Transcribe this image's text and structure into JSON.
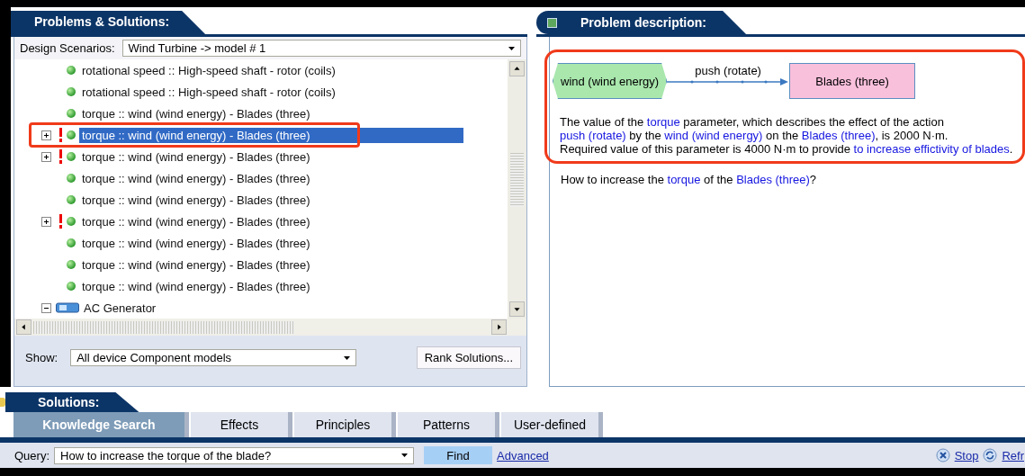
{
  "problems_panel": {
    "title": "Problems & Solutions:",
    "scenario_label": "Design Scenarios:",
    "scenario_value": "Wind Turbine -> model # 1",
    "tree": [
      {
        "kind": "parameter",
        "label": "rotational speed :: High-speed shaft - rotor (coils)",
        "expandable": false,
        "warning": false,
        "selected": false,
        "highlighted": false
      },
      {
        "kind": "parameter",
        "label": "rotational speed :: High-speed shaft - rotor (coils)",
        "expandable": false,
        "warning": false,
        "selected": false,
        "highlighted": false
      },
      {
        "kind": "parameter",
        "label": "torque :: wind (wind energy) - Blades (three)",
        "expandable": false,
        "warning": false,
        "selected": false,
        "highlighted": false
      },
      {
        "kind": "parameter",
        "label": "torque :: wind (wind energy) - Blades (three)",
        "expandable": true,
        "expanded": false,
        "warning": true,
        "selected": true,
        "highlighted": true
      },
      {
        "kind": "parameter",
        "label": "torque :: wind (wind energy) - Blades (three)",
        "expandable": true,
        "expanded": false,
        "warning": true,
        "selected": false,
        "highlighted": false
      },
      {
        "kind": "parameter",
        "label": "torque :: wind (wind energy) - Blades (three)",
        "expandable": false,
        "warning": false,
        "selected": false,
        "highlighted": false
      },
      {
        "kind": "parameter",
        "label": "torque :: wind (wind energy) - Blades (three)",
        "expandable": false,
        "warning": false,
        "selected": false,
        "highlighted": false
      },
      {
        "kind": "parameter",
        "label": "torque :: wind (wind energy) - Blades (three)",
        "expandable": true,
        "expanded": false,
        "warning": true,
        "selected": false,
        "highlighted": false
      },
      {
        "kind": "parameter",
        "label": "torque :: wind (wind energy) - Blades (three)",
        "expandable": false,
        "warning": false,
        "selected": false,
        "highlighted": false
      },
      {
        "kind": "parameter",
        "label": "torque :: wind (wind energy) - Blades (three)",
        "expandable": false,
        "warning": false,
        "selected": false,
        "highlighted": false
      },
      {
        "kind": "parameter",
        "label": "torque :: wind (wind energy) - Blades (three)",
        "expandable": false,
        "warning": false,
        "selected": false,
        "highlighted": false
      },
      {
        "kind": "component",
        "label": "AC Generator",
        "expandable": true,
        "expanded": true,
        "selected": false,
        "highlighted": false
      }
    ],
    "show_label": "Show:",
    "show_value": "All device Component models",
    "rank_button": "Rank Solutions..."
  },
  "description_panel": {
    "title": "Problem description:",
    "diagram": {
      "source": "wind (wind energy)",
      "action": "push (rotate)",
      "target": "Blades (three)"
    },
    "paragraph": [
      {
        "kind": "text",
        "text": "The value of the "
      },
      {
        "kind": "term",
        "text": "torque"
      },
      {
        "kind": "text",
        "text": " parameter, which describes the effect of the action "
      },
      {
        "kind": "term",
        "text": "push (rotate)"
      },
      {
        "kind": "text",
        "text": " by the "
      },
      {
        "kind": "term",
        "text": "wind (wind energy)"
      },
      {
        "kind": "text",
        "text": " on the "
      },
      {
        "kind": "term",
        "text": "Blades (three)"
      },
      {
        "kind": "text",
        "text": ", is 2000 N·m."
      },
      {
        "kind": "break"
      },
      {
        "kind": "text",
        "text": "Required value of this parameter is 4000 N·m to provide "
      },
      {
        "kind": "term",
        "text": "to increase effictivity of blades"
      },
      {
        "kind": "text",
        "text": "."
      }
    ],
    "question": [
      {
        "kind": "text",
        "text": "How to increase the "
      },
      {
        "kind": "term",
        "text": "torque"
      },
      {
        "kind": "text",
        "text": " of the "
      },
      {
        "kind": "term",
        "text": "Blades (three)"
      },
      {
        "kind": "text",
        "text": "?"
      }
    ]
  },
  "solutions_panel": {
    "title": "Solutions:",
    "tabs": [
      {
        "label": "Knowledge Search",
        "selected": true
      },
      {
        "label": "Effects",
        "selected": false
      },
      {
        "label": "Principles",
        "selected": false
      },
      {
        "label": "Patterns",
        "selected": false
      },
      {
        "label": "User-defined",
        "selected": false
      }
    ],
    "query_label": "Query:",
    "query_value": "How to increase the torque of the blade?",
    "find_button": "Find",
    "advanced_link": "Advanced",
    "stop_link": "Stop",
    "refresh_link": "Refr"
  }
}
